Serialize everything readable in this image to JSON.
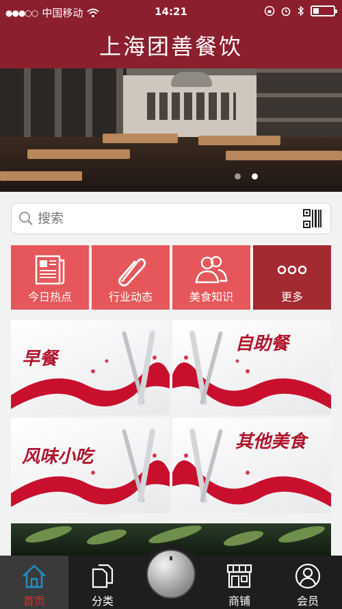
{
  "status_bar": {
    "carrier": "中国移动",
    "time": "14:21"
  },
  "header": {
    "title": "上海团善餐饮"
  },
  "search": {
    "placeholder": "搜索"
  },
  "categories": [
    {
      "label": "今日热点",
      "icon": "newspaper-icon",
      "color": "#e5575a"
    },
    {
      "label": "行业动态",
      "icon": "paperclip-icon",
      "color": "#e5575a"
    },
    {
      "label": "美食知识",
      "icon": "users-icon",
      "color": "#e5575a"
    },
    {
      "label": "更多",
      "icon": "more-dots-icon",
      "color": "#a42a31"
    }
  ],
  "tiles": [
    {
      "label": "早餐"
    },
    {
      "label": "自助餐"
    },
    {
      "label": "风味小吃"
    },
    {
      "label": "其他美食"
    }
  ],
  "tabbar": [
    {
      "label": "首页",
      "icon": "home-icon",
      "active": true
    },
    {
      "label": "分类",
      "icon": "documents-icon",
      "active": false
    },
    {
      "label": "商铺",
      "icon": "shop-icon",
      "active": false
    },
    {
      "label": "会员",
      "icon": "member-icon",
      "active": false
    }
  ],
  "colors": {
    "brand": "#8b1f2e",
    "category_red": "#e5575a",
    "category_dark": "#a42a31",
    "active_tab": "#d8302f"
  }
}
